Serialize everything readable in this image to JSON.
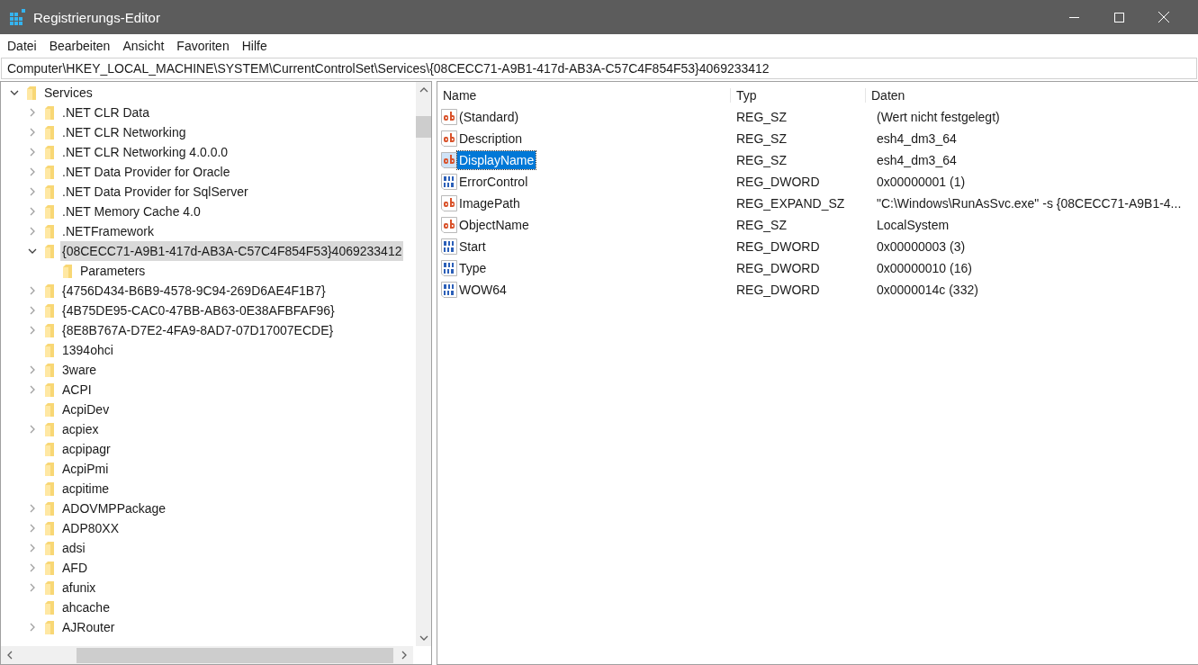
{
  "window": {
    "title": "Registrierungs-Editor"
  },
  "menu": [
    "Datei",
    "Bearbeiten",
    "Ansicht",
    "Favoriten",
    "Hilfe"
  ],
  "address": "Computer\\HKEY_LOCAL_MACHINE\\SYSTEM\\CurrentControlSet\\Services\\{08CECC71-A9B1-417d-AB3A-C57C4F854F53}4069233412",
  "tree": [
    {
      "label": "Services",
      "expanded": true,
      "selected": false,
      "children": [
        {
          "label": ".NET CLR Data",
          "expanded": false,
          "selected": false
        },
        {
          "label": ".NET CLR Networking",
          "expanded": false,
          "selected": false
        },
        {
          "label": ".NET CLR Networking 4.0.0.0",
          "expanded": false,
          "selected": false
        },
        {
          "label": ".NET Data Provider for Oracle",
          "expanded": false,
          "selected": false
        },
        {
          "label": ".NET Data Provider for SqlServer",
          "expanded": false,
          "selected": false
        },
        {
          "label": ".NET Memory Cache 4.0",
          "expanded": false,
          "selected": false
        },
        {
          "label": ".NETFramework",
          "expanded": false,
          "selected": false
        },
        {
          "label": "{08CECC71-A9B1-417d-AB3A-C57C4F854F53}4069233412",
          "expanded": true,
          "selected": true,
          "children": [
            {
              "label": "Parameters",
              "selected": false
            }
          ]
        },
        {
          "label": "{4756D434-B6B9-4578-9C94-269D6AE4F1B7}",
          "expanded": false,
          "selected": false
        },
        {
          "label": "{4B75DE95-CAC0-47BB-AB63-0E38AFBFAF96}",
          "expanded": false,
          "selected": false
        },
        {
          "label": "{8E8B767A-D7E2-4FA9-8AD7-07D17007ECDE}",
          "expanded": false,
          "selected": false
        },
        {
          "label": "1394ohci",
          "selected": false
        },
        {
          "label": "3ware",
          "expanded": false,
          "selected": false
        },
        {
          "label": "ACPI",
          "expanded": false,
          "selected": false
        },
        {
          "label": "AcpiDev",
          "selected": false
        },
        {
          "label": "acpiex",
          "expanded": false,
          "selected": false
        },
        {
          "label": "acpipagr",
          "selected": false
        },
        {
          "label": "AcpiPmi",
          "selected": false
        },
        {
          "label": "acpitime",
          "selected": false
        },
        {
          "label": "ADOVMPPackage",
          "expanded": false,
          "selected": false
        },
        {
          "label": "ADP80XX",
          "expanded": false,
          "selected": false
        },
        {
          "label": "adsi",
          "expanded": false,
          "selected": false
        },
        {
          "label": "AFD",
          "expanded": false,
          "selected": false
        },
        {
          "label": "afunix",
          "expanded": false,
          "selected": false
        },
        {
          "label": "ahcache",
          "selected": false
        },
        {
          "label": "AJRouter",
          "expanded": false,
          "selected": false
        }
      ]
    }
  ],
  "table": {
    "columns": [
      "Name",
      "Typ",
      "Daten"
    ],
    "rows": [
      {
        "kind": "string",
        "name": "(Standard)",
        "type": "REG_SZ",
        "data": "(Wert nicht festgelegt)",
        "selected": false
      },
      {
        "kind": "string",
        "name": "Description",
        "type": "REG_SZ",
        "data": "esh4_dm3_64",
        "selected": false
      },
      {
        "kind": "string",
        "name": "DisplayName",
        "type": "REG_SZ",
        "data": "esh4_dm3_64",
        "selected": true
      },
      {
        "kind": "binary",
        "name": "ErrorControl",
        "type": "REG_DWORD",
        "data": "0x00000001 (1)",
        "selected": false
      },
      {
        "kind": "string",
        "name": "ImagePath",
        "type": "REG_EXPAND_SZ",
        "data": "\"C:\\Windows\\RunAsSvc.exe\" -s {08CECC71-A9B1-4...",
        "selected": false
      },
      {
        "kind": "string",
        "name": "ObjectName",
        "type": "REG_SZ",
        "data": "LocalSystem",
        "selected": false
      },
      {
        "kind": "binary",
        "name": "Start",
        "type": "REG_DWORD",
        "data": "0x00000003 (3)",
        "selected": false
      },
      {
        "kind": "binary",
        "name": "Type",
        "type": "REG_DWORD",
        "data": "0x00000010 (16)",
        "selected": false
      },
      {
        "kind": "binary",
        "name": "WOW64",
        "type": "REG_DWORD",
        "data": "0x0000014c (332)",
        "selected": false
      }
    ]
  }
}
